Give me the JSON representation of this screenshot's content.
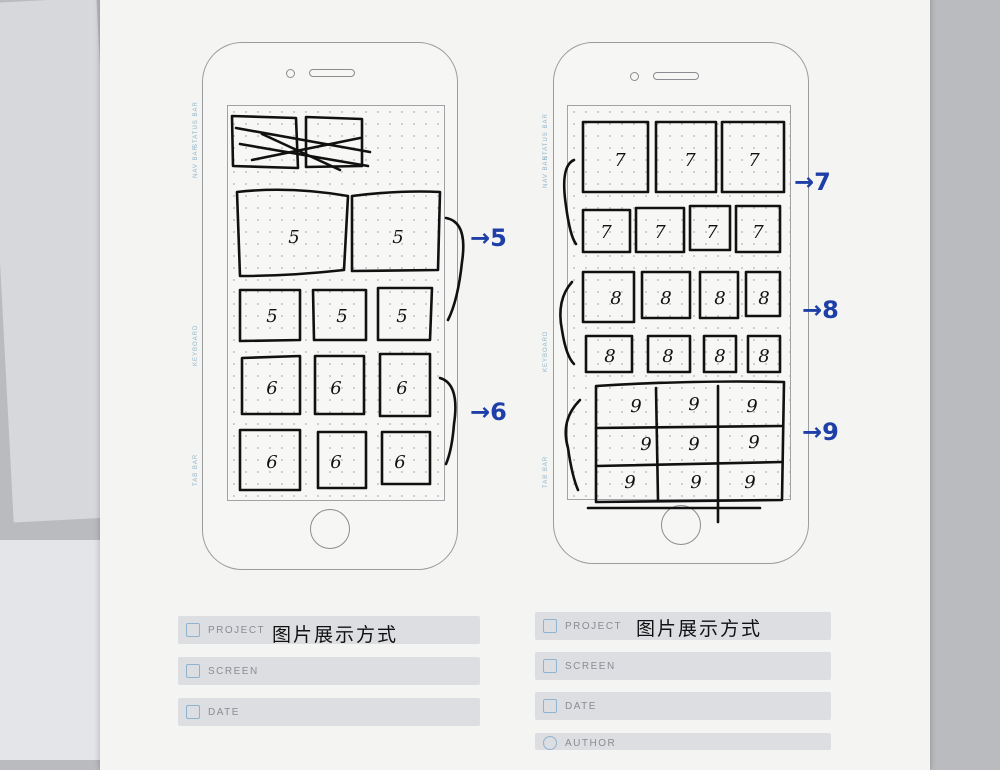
{
  "phones": [
    {
      "id": "left",
      "side_labels": {
        "status_bar": "STATUS BAR",
        "nav_bar": "NAV BAR",
        "keyboard": "KEYBOARD",
        "tab_bar": "TAB BAR"
      },
      "large_tiles": [
        "5",
        "5"
      ],
      "rows": [
        [
          "5",
          "5",
          "5"
        ],
        [
          "6",
          "6",
          "6"
        ],
        [
          "6",
          "6",
          "6"
        ]
      ],
      "annotations": [
        "→5",
        "→6"
      ]
    },
    {
      "id": "right",
      "side_labels": {
        "status_bar": "STATUS BAR",
        "nav_bar": "NAV BAR",
        "keyboard": "KEYBOARD",
        "tab_bar": "TAB BAR"
      },
      "rows": [
        [
          "7",
          "7",
          "7"
        ],
        [
          "7",
          "7",
          "7",
          "7"
        ],
        [
          "8",
          "8",
          "8",
          "8"
        ],
        [
          "8",
          "8",
          "8",
          "8"
        ]
      ],
      "grid": [
        [
          "9",
          "9",
          "9"
        ],
        [
          "9",
          "9",
          "9"
        ],
        [
          "9",
          "9",
          "9"
        ]
      ],
      "annotations": [
        "→7",
        "→8",
        "→9"
      ]
    }
  ],
  "forms": [
    {
      "fields": [
        {
          "label": "PROJECT",
          "icon": "calendar-icon",
          "value": "图片展示方式"
        },
        {
          "label": "SCREEN",
          "icon": "book-icon",
          "value": ""
        },
        {
          "label": "DATE",
          "icon": "calendar-icon",
          "value": ""
        }
      ]
    },
    {
      "fields": [
        {
          "label": "PROJECT",
          "icon": "calendar-icon",
          "value": "图片展示方式"
        },
        {
          "label": "SCREEN",
          "icon": "book-icon",
          "value": ""
        },
        {
          "label": "DATE",
          "icon": "calendar-icon",
          "value": ""
        },
        {
          "label": "AUTHOR",
          "icon": "person-icon",
          "value": ""
        }
      ]
    }
  ],
  "colors": {
    "ink": "#111111",
    "annotation_ink": "#1f3fa8",
    "form_row": "#dcdee2",
    "accent_icon": "#8fb4d0"
  }
}
